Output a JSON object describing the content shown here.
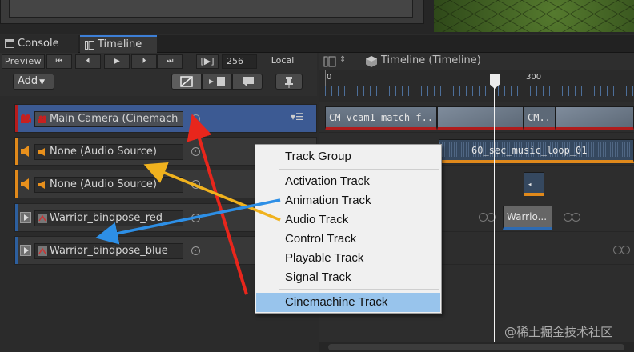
{
  "tabs": [
    {
      "label": "Console",
      "icon": "console-icon"
    },
    {
      "label": "Timeline",
      "icon": "timeline-icon"
    }
  ],
  "toolbar": {
    "preview_label": "Preview",
    "frame_value": "256",
    "time_mode": "Local",
    "add_label": "Add",
    "timeline_title": "Timeline (Timeline)"
  },
  "ruler": {
    "labels": [
      "0",
      "300"
    ]
  },
  "tracks": [
    {
      "name": "Main Camera (Cinemach",
      "type": "cinemachine",
      "accent": "#b71c1c"
    },
    {
      "name": "None (Audio Source)",
      "type": "audio",
      "accent": "#e0891b"
    },
    {
      "name": "None (Audio Source)",
      "type": "audio",
      "accent": "#e0891b"
    },
    {
      "name": "Warrior_bindpose_red",
      "type": "animation",
      "accent": "#2d5f9e"
    },
    {
      "name": "Warrior_bindpose_blue",
      "type": "animation",
      "accent": "#2d5f9e"
    }
  ],
  "clips": {
    "vcam": "CM vcam1 match f..",
    "cm2": "CM..",
    "audio": "60_sec_music_loop_01",
    "warrior": "Warrio..."
  },
  "menu": {
    "items": [
      "Track Group",
      "Activation Track",
      "Animation Track",
      "Audio Track",
      "Control Track",
      "Playable Track",
      "Signal Track",
      "Cinemachine Track"
    ],
    "selected": "Cinemachine Track"
  },
  "annotations": {
    "arrow_colors": [
      "#e8261c",
      "#f0b21e",
      "#2d8fe6"
    ]
  },
  "watermark": "@稀土掘金技术社区"
}
